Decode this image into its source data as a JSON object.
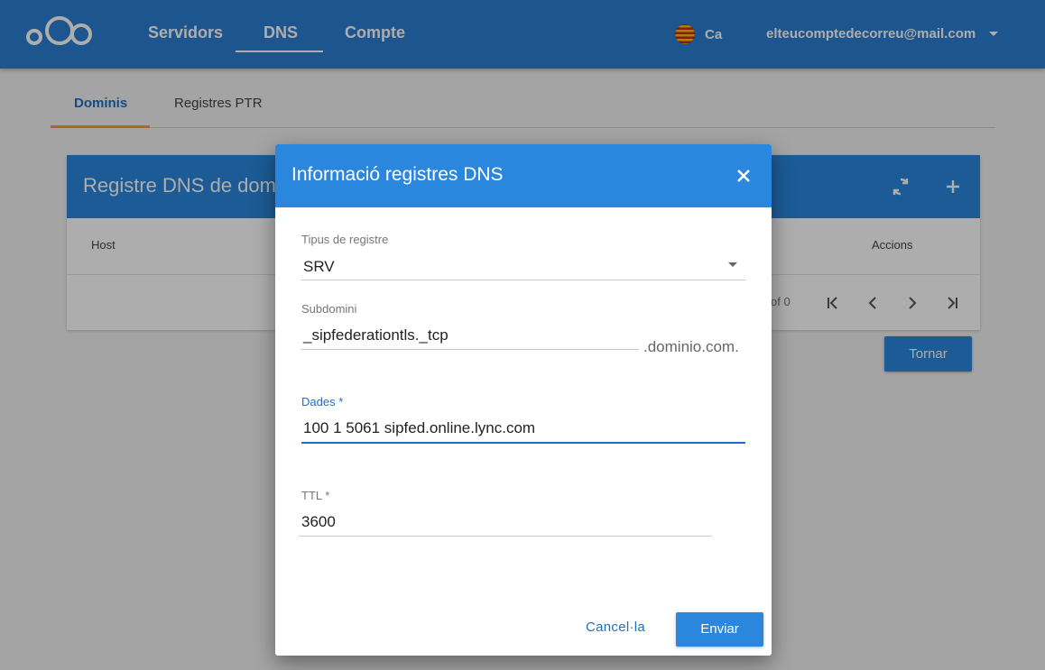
{
  "header": {
    "nav": [
      "Servidors",
      "DNS",
      "Compte"
    ],
    "language": "Ca",
    "account": "elteucomptedecorreu@mail.com"
  },
  "subtabs": [
    "Dominis",
    "Registres PTR"
  ],
  "card": {
    "title": "Registre DNS de dom",
    "columns": [
      "Host",
      "Accions"
    ],
    "pager_text": "of 0"
  },
  "back_button": "Tornar",
  "dialog": {
    "title": "Informació registres DNS",
    "type_label": "Tipus de registre",
    "type_value": "SRV",
    "subdomain_label": "Subdomini",
    "subdomain_value": "_sipfederationtls._tcp",
    "domain_suffix": ".dominio.com.",
    "data_label": "Dades",
    "data_value": "100 1 5061 sipfed.online.lync.com",
    "ttl_label": "TTL",
    "ttl_value": "3600",
    "required_mark": "*",
    "cancel_label": "Cancel·la",
    "submit_label": "Enviar"
  },
  "colors": {
    "primary": "#2b87de",
    "header": "#2b7fd2",
    "accent": "#f0a030",
    "link": "#1e6fc4"
  }
}
